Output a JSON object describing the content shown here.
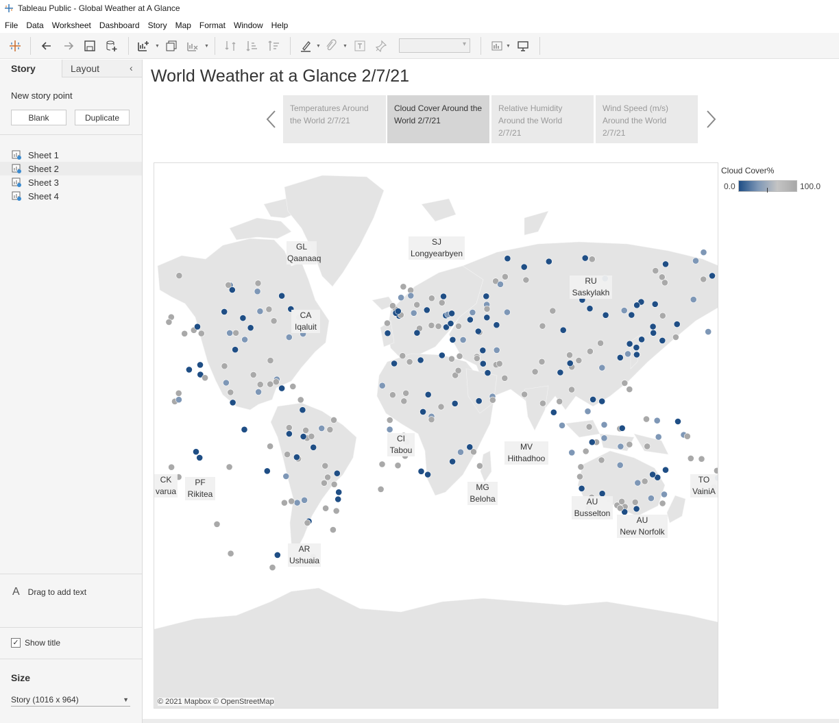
{
  "window": {
    "title": "Tableau Public - Global Weather at A Glance"
  },
  "menu": [
    "File",
    "Data",
    "Worksheet",
    "Dashboard",
    "Story",
    "Map",
    "Format",
    "Window",
    "Help"
  ],
  "left_pane": {
    "tabs": {
      "story": "Story",
      "layout": "Layout"
    },
    "new_story_point": "New story point",
    "blank_button": "Blank",
    "duplicate_button": "Duplicate",
    "sheets": [
      "Sheet 1",
      "Sheet 2",
      "Sheet 3",
      "Sheet 4"
    ],
    "drag_text": "Drag to add text",
    "show_title": "Show title",
    "show_title_checked": true,
    "size_label": "Size",
    "size_value": "Story (1016 x 964)"
  },
  "story": {
    "title": "World Weather at a Glance 2/7/21",
    "points": [
      {
        "label": "Temperatures Around the World 2/7/21",
        "active": false
      },
      {
        "label": "Cloud Cover Around the World 2/7/21",
        "active": true
      },
      {
        "label": "Relative Humidity Around the World 2/7/21",
        "active": false
      },
      {
        "label": "Wind Speed (m/s) Around the World 2/7/21",
        "active": false
      }
    ]
  },
  "map": {
    "credit": "© 2021 Mapbox © OpenStreetMap",
    "labels": [
      {
        "code": "GL",
        "city": "Qaanaaq"
      },
      {
        "code": "SJ",
        "city": "Longyearbyen"
      },
      {
        "code": "RU",
        "city": "Saskylakh"
      },
      {
        "code": "CA",
        "city": "Iqaluit"
      },
      {
        "code": "CI",
        "city": "Tabou"
      },
      {
        "code": "MV",
        "city": "Hithadhoo"
      },
      {
        "code": "MG",
        "city": "Beloha"
      },
      {
        "code": "AU",
        "city": "Busselton"
      },
      {
        "code": "AU",
        "city": "New Norfolk"
      },
      {
        "code": "TO",
        "city": "VainiA"
      },
      {
        "code": "PF",
        "city": "Rikitea"
      },
      {
        "code": "CK",
        "city": "varua"
      },
      {
        "code": "AR",
        "city": "Ushuaia"
      }
    ]
  },
  "legend": {
    "title": "Cloud Cover%",
    "min": "0.0",
    "max": "100.0",
    "low_color": "#1f4e85",
    "high_color": "#a8a8a8"
  },
  "colors": {
    "cloud_low": "#1f4e85",
    "cloud_mid": "#7e97b6",
    "cloud_high": "#a9a9a9",
    "land": "#e4e4e4"
  }
}
